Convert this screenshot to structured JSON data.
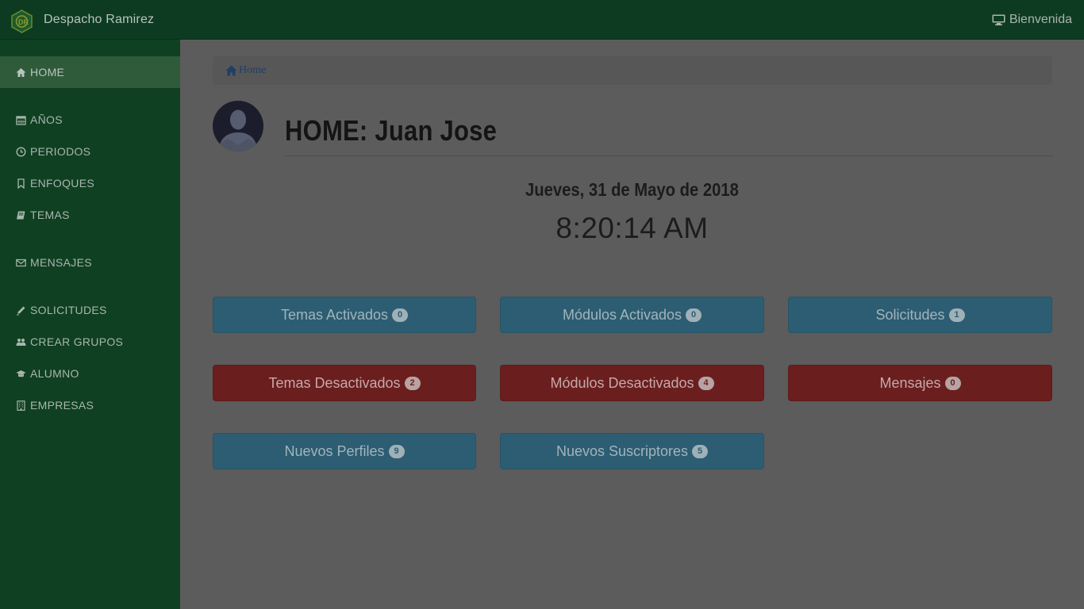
{
  "header": {
    "brand": "Despacho Ramirez",
    "welcome": "Bienvenida"
  },
  "sidebar": {
    "items": [
      {
        "label": "HOME",
        "icon": "home-icon"
      },
      {
        "label": "AÑOS",
        "icon": "calendar-icon"
      },
      {
        "label": "PERIODOS",
        "icon": "clock-icon"
      },
      {
        "label": "ENFOQUES",
        "icon": "bookmark-icon"
      },
      {
        "label": "TEMAS",
        "icon": "book-icon"
      },
      {
        "label": "MENSAJES",
        "icon": "envelope-icon"
      },
      {
        "label": "SOLICITUDES",
        "icon": "pencil-icon"
      },
      {
        "label": "CREAR GRUPOS",
        "icon": "users-icon"
      },
      {
        "label": "ALUMNO",
        "icon": "graduation-cap-icon"
      },
      {
        "label": "EMPRESAS",
        "icon": "building-icon"
      }
    ]
  },
  "breadcrumb": {
    "home": "Home"
  },
  "page": {
    "title": "HOME: Juan Jose",
    "date": "Jueves, 31 de Mayo de 2018",
    "time": "8:20:14 AM"
  },
  "tiles": [
    {
      "label": "Temas Activados",
      "count": "0",
      "variant": "blue"
    },
    {
      "label": "Módulos Activados",
      "count": "0",
      "variant": "blue"
    },
    {
      "label": "Solicitudes",
      "count": "1",
      "variant": "blue"
    },
    {
      "label": "Temas Desactivados",
      "count": "2",
      "variant": "red"
    },
    {
      "label": "Módulos Desactivados",
      "count": "4",
      "variant": "red"
    },
    {
      "label": "Mensajes",
      "count": "0",
      "variant": "red"
    },
    {
      "label": "Nuevos Perfiles",
      "count": "9",
      "variant": "blue"
    },
    {
      "label": "Nuevos Suscriptores",
      "count": "5",
      "variant": "blue"
    }
  ],
  "colors": {
    "navbar": "#0d3b21",
    "sidebar": "#0f4022",
    "overlay_bg": "#5c5c5c",
    "tile_blue": "#2c5d72",
    "tile_red": "#6b1e1e"
  }
}
